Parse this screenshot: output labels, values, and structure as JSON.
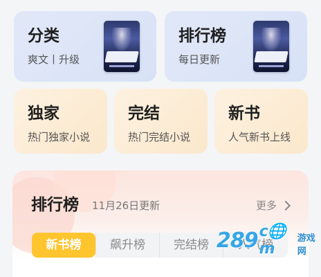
{
  "cards_top": [
    {
      "title": "分类",
      "subtitle": "爽文丨升级"
    },
    {
      "title": "排行榜",
      "subtitle": "每日更新"
    }
  ],
  "cards_mid": [
    {
      "title": "独家",
      "subtitle": "热门独家小说"
    },
    {
      "title": "完结",
      "subtitle": "热门完结小说"
    },
    {
      "title": "新书",
      "subtitle": "人气新书上线"
    }
  ],
  "ranking": {
    "title": "排行榜",
    "date": "11月26日更新",
    "more": "更多",
    "tabs": [
      "新书榜",
      "飙升榜",
      "完结榜",
      "人气榜"
    ],
    "active_tab": "新书榜"
  },
  "watermark": {
    "digits": "289",
    "suffix": "c🌐m",
    "sub": "游戏网"
  },
  "colors": {
    "card_blue": "#dfe7f8",
    "card_orange": "#fcedd8",
    "tab_active": "#ffc52f",
    "watermark": "#37a6e6"
  }
}
